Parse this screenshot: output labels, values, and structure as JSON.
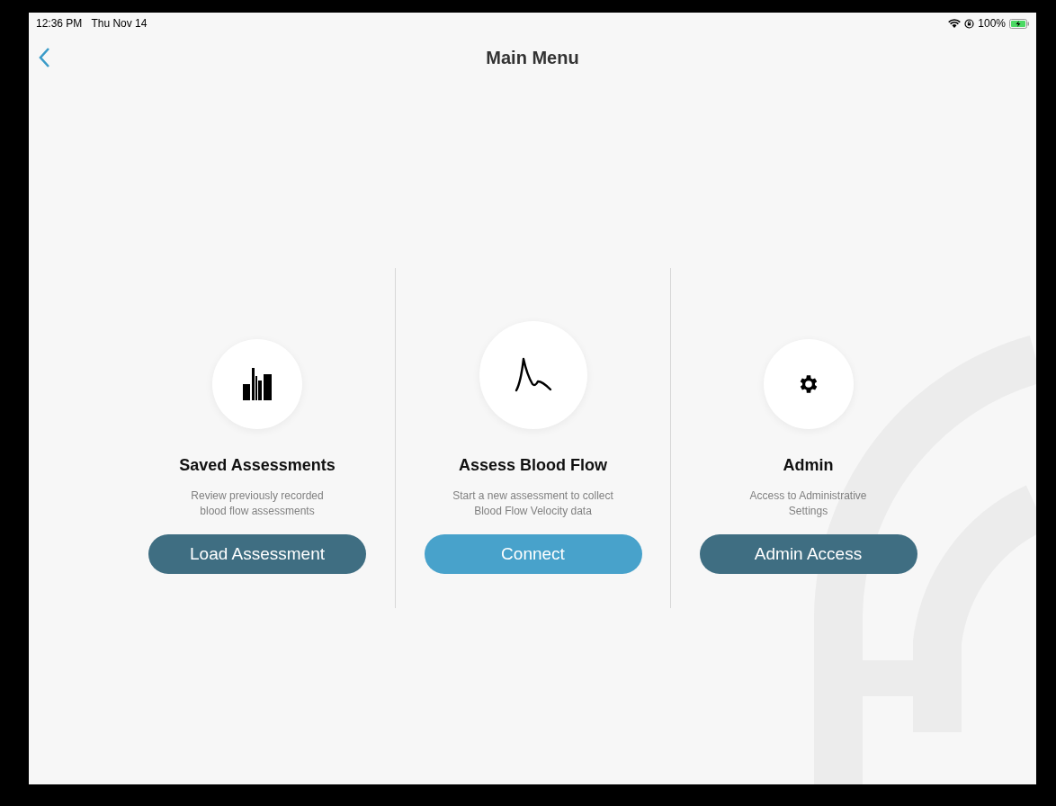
{
  "status_bar": {
    "time": "12:36 PM",
    "date": "Thu Nov 14",
    "battery": "100%",
    "charging": true
  },
  "header": {
    "title": "Main Menu"
  },
  "cards": [
    {
      "kind": "bar-chart",
      "title": "Saved Assessments",
      "description": "Review previously recorded\nblood flow assessments",
      "button": "Load Assessment",
      "highlighted": false
    },
    {
      "kind": "waveform",
      "title": "Assess Blood Flow",
      "description": "Start a new assessment to collect\nBlood Flow Velocity data",
      "button": "Connect",
      "highlighted": true
    },
    {
      "kind": "gear",
      "title": "Admin",
      "description": "Access to Administrative\nSettings",
      "button": "Admin Access",
      "highlighted": false
    }
  ]
}
